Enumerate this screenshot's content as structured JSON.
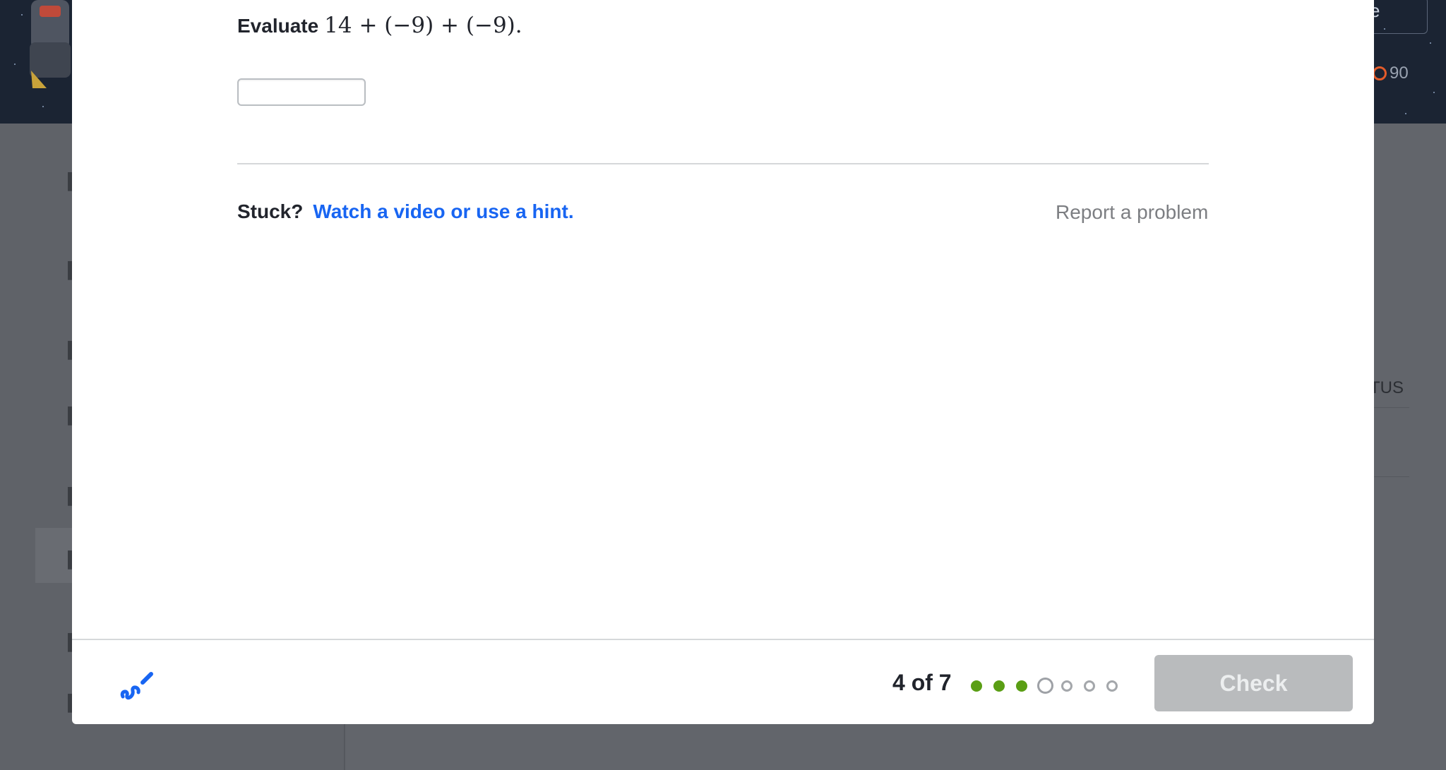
{
  "background": {
    "header_button_text": "e",
    "points_value": "90",
    "status_column_text": "TUS"
  },
  "question": {
    "label": "Evaluate",
    "expression": "14 + (−9) + (−9).",
    "answer_value": "",
    "answer_placeholder": ""
  },
  "help": {
    "stuck_label": "Stuck?",
    "hint_link": "Watch a video or use a hint.",
    "report_link": "Report a problem"
  },
  "footer": {
    "scratchpad_icon": "scratchpad-pencil-icon",
    "progress_text": "4 of 7",
    "progress": {
      "current": 4,
      "total": 7,
      "states": [
        "done",
        "done",
        "done",
        "current",
        "todo",
        "todo",
        "todo"
      ]
    },
    "check_label": "Check",
    "check_enabled": false
  },
  "colors": {
    "link_blue": "#1865f2",
    "done_green": "#5a9e14",
    "disabled_button": "#b9bbbd",
    "text_dark": "#21242c",
    "overlay": "#62656b"
  }
}
